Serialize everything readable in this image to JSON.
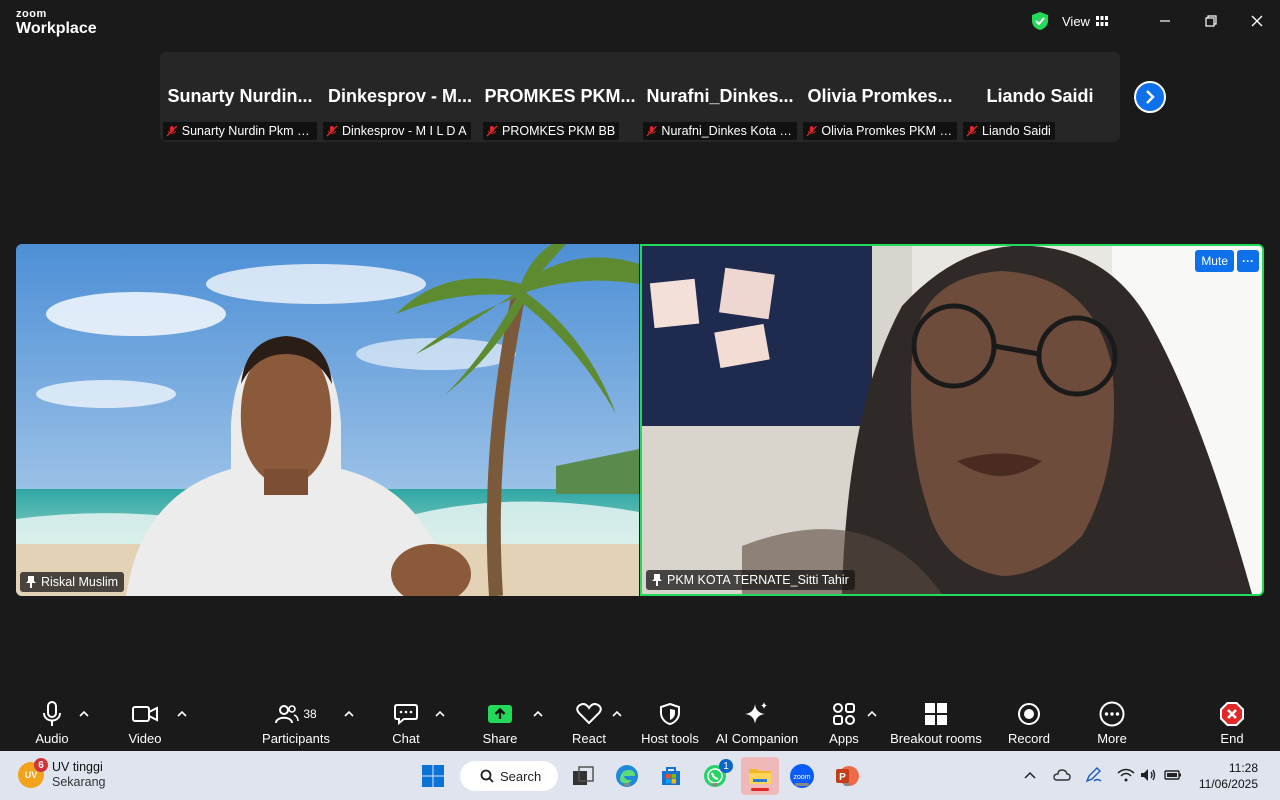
{
  "app": {
    "brand_top": "zoom",
    "brand_bottom": "Workplace",
    "view_label": "View"
  },
  "gallery": [
    {
      "big": "Sunarty  Nurdin...",
      "tag": "Sunarty Nurdin Pkm S..."
    },
    {
      "big": "Dinkesprov  - M...",
      "tag": "Dinkesprov - M I L D A"
    },
    {
      "big": "PROMKES  PKM...",
      "tag": "PROMKES PKM BB"
    },
    {
      "big": "Nurafni_Dinkes...",
      "tag": "Nurafni_Dinkes Kota Ti..."
    },
    {
      "big": "Olivia  Promkes...",
      "tag": "Olivia Promkes PKM G..."
    },
    {
      "big": "Liando Saidi",
      "tag": "Liando Saidi"
    }
  ],
  "videos": {
    "left": {
      "name": "Riskal Muslim"
    },
    "right": {
      "name": "PKM KOTA TERNATE_Sitti Tahir",
      "mute_label": "Mute",
      "more_label": "···"
    }
  },
  "toolbar": {
    "audio": "Audio",
    "video": "Video",
    "participants": "Participants",
    "participants_count": "38",
    "chat": "Chat",
    "share": "Share",
    "react": "React",
    "host_tools": "Host tools",
    "ai_companion": "AI Companion",
    "apps": "Apps",
    "breakout": "Breakout rooms",
    "record": "Record",
    "more": "More",
    "end": "End"
  },
  "taskbar": {
    "weather_title": "UV tinggi",
    "weather_sub": "Sekarang",
    "weather_icon_text": "UV",
    "weather_badge": "6",
    "search_label": "Search",
    "whatsapp_badge": "1",
    "time": "11:28",
    "date": "11/06/2025"
  },
  "colors": {
    "accent": "#0e71eb",
    "active_speaker": "#23d959",
    "muted": "#e02828",
    "share_green": "#23d959",
    "end_red": "#e02828"
  }
}
